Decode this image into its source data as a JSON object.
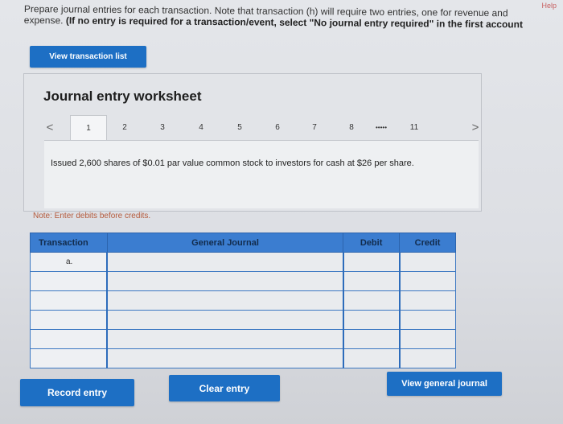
{
  "header": {
    "help": "Help",
    "instructions_line1": "Prepare journal entries for each transaction. Note that transaction (h) will require two entries, one for revenue and",
    "instructions_line2_normal": "expense. ",
    "instructions_line2_bold": "(If no entry is required for a transaction/event, select \"No journal entry required\" in the first account"
  },
  "buttons": {
    "view_transaction_list": "View transaction list",
    "record_entry": "Record entry",
    "clear_entry": "Clear entry",
    "view_general_journal": "View general journal"
  },
  "worksheet": {
    "title": "Journal entry worksheet",
    "prev_arrow": "<",
    "next_arrow": ">",
    "pages": [
      "1",
      "2",
      "3",
      "4",
      "5",
      "6",
      "7",
      "8",
      "11"
    ],
    "ellipsis": "•••••",
    "active_page": "1",
    "description": "Issued 2,600 shares of $0.01 par value common stock to investors for cash at $26 per share."
  },
  "note": "Note: Enter debits before credits.",
  "table": {
    "headers": [
      "Transaction",
      "General Journal",
      "Debit",
      "Credit"
    ],
    "rows": [
      {
        "transaction": "a."
      },
      {
        "transaction": ""
      },
      {
        "transaction": ""
      },
      {
        "transaction": ""
      },
      {
        "transaction": ""
      },
      {
        "transaction": ""
      }
    ]
  },
  "colors": {
    "accent": "#1d6fc4",
    "table_header": "#3b7dd0",
    "note": "#b55a3b"
  }
}
